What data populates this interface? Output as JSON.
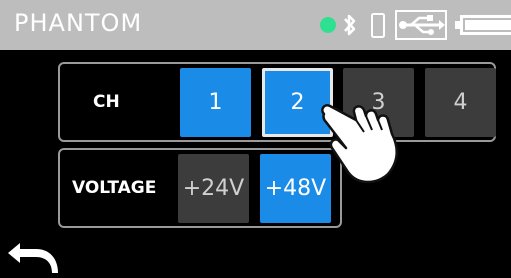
{
  "header": {
    "title": "PHANTOM",
    "status_color": "#2fe090",
    "icons": [
      "status-dot-icon",
      "bluetooth-icon",
      "phone-icon",
      "usb-icon",
      "battery-icon"
    ]
  },
  "channel": {
    "label": "CH",
    "buttons": [
      {
        "label": "1",
        "state": "on"
      },
      {
        "label": "2",
        "state": "on"
      },
      {
        "label": "3",
        "state": "off"
      },
      {
        "label": "4",
        "state": "off"
      }
    ]
  },
  "voltage": {
    "label": "VOLTAGE",
    "buttons": [
      {
        "label": "+24V",
        "state": "off"
      },
      {
        "label": "+48V",
        "state": "on"
      }
    ]
  },
  "footer": {
    "back_icon": "back-arrow-icon"
  },
  "colors": {
    "header_bg": "#bdbdbd",
    "active": "#1a8ce8",
    "inactive": "#3c3c3c"
  }
}
